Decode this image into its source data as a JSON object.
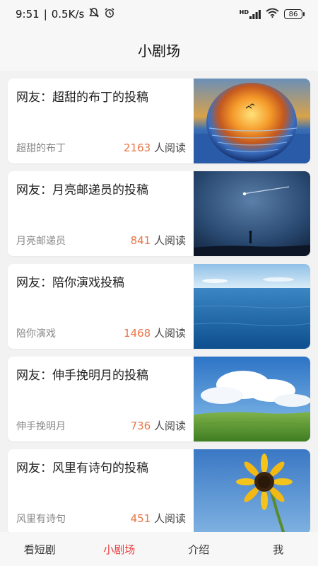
{
  "status_bar": {
    "time": "9:51",
    "network_speed": "0.5K/s",
    "signal_label": "HD",
    "battery": "86",
    "icons": [
      "mute-icon",
      "alarm-icon",
      "signal-icon",
      "wifi-icon",
      "battery-icon"
    ]
  },
  "header": {
    "title": "小剧场"
  },
  "cards": [
    {
      "title": "网友：超甜的布丁的投稿",
      "author": "超甜的布丁",
      "reads": "2163",
      "reads_suffix": " 人阅读",
      "image": "sunset-sphere"
    },
    {
      "title": "网友：月亮邮递员的投稿",
      "author": "月亮邮递员",
      "reads": "841",
      "reads_suffix": " 人阅读",
      "image": "night-meteor"
    },
    {
      "title": "网友：陪你演戏投稿",
      "author": "陪你演戏",
      "reads": "1468",
      "reads_suffix": " 人阅读",
      "image": "ocean-horizon"
    },
    {
      "title": "网友：伸手挽明月的投稿",
      "author": "伸手挽明月",
      "reads": "736",
      "reads_suffix": " 人阅读",
      "image": "grassland-clouds"
    },
    {
      "title": "网友：风里有诗句的投稿",
      "author": "风里有诗句",
      "reads": "451",
      "reads_suffix": " 人阅读",
      "image": "sunflower-sky"
    }
  ],
  "tabs": [
    {
      "label": "看短剧",
      "active": false
    },
    {
      "label": "小剧场",
      "active": true
    },
    {
      "label": "介绍",
      "active": false
    },
    {
      "label": "我",
      "active": false
    }
  ],
  "colors": {
    "accent": "#e84040",
    "count": "#e97546"
  }
}
